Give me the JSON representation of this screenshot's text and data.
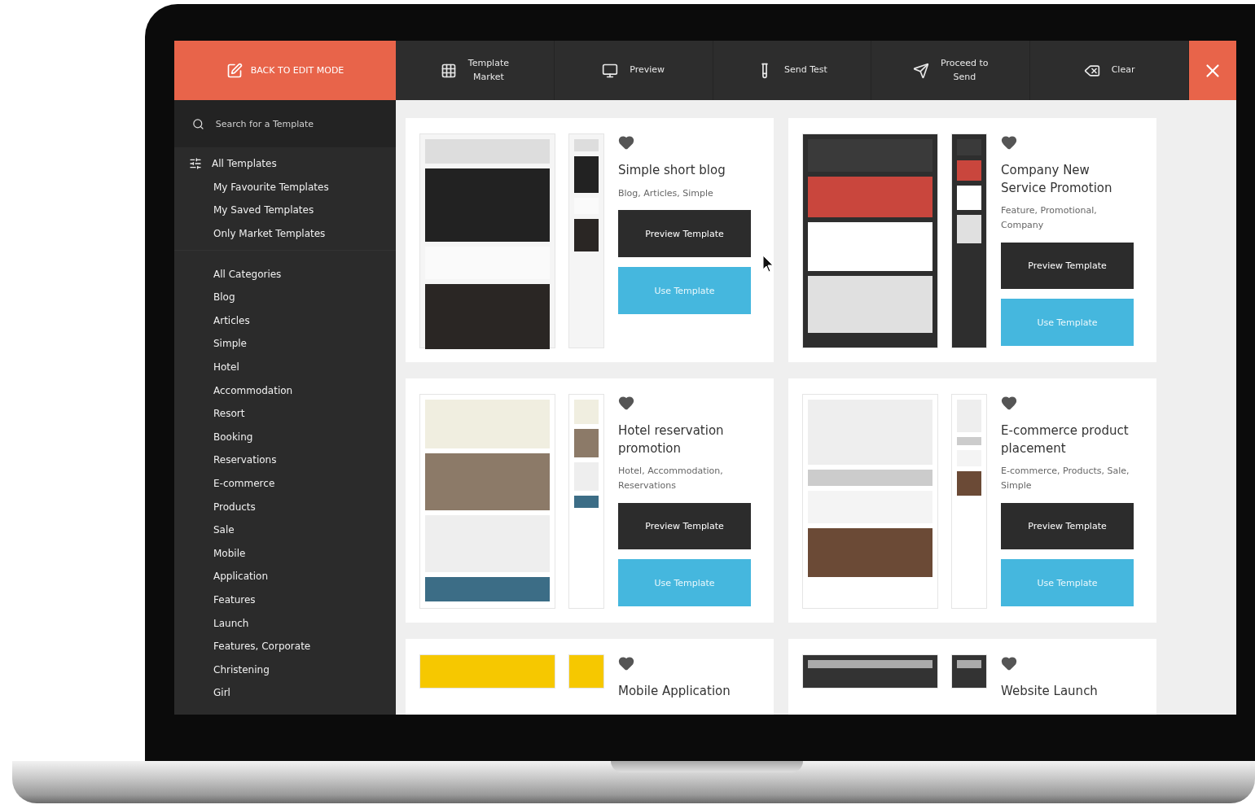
{
  "toolbar": {
    "back": {
      "label": "BACK TO EDIT MODE"
    },
    "items": [
      {
        "label": "Template\nMarket"
      },
      {
        "label": "Preview"
      },
      {
        "label": "Send Test"
      },
      {
        "label": "Proceed to\nSend"
      },
      {
        "label": "Clear"
      }
    ]
  },
  "sidebar": {
    "search": {
      "placeholder": "Search for a Template"
    },
    "filters": [
      "All Templates",
      "My Favourite Templates",
      "My Saved Templates",
      "Only Market Templates"
    ],
    "categories": [
      "All Categories",
      "Blog",
      "Articles",
      "Simple",
      "Hotel",
      "Accommodation",
      "Resort",
      "Booking",
      "Reservations",
      "E-commerce",
      "Products",
      "Sale",
      "Mobile",
      "Application",
      "Features",
      "Launch",
      "Features, Corporate",
      "Christening",
      "Girl"
    ]
  },
  "templates": [
    {
      "title": "Simple short blog",
      "tags": "Blog, Articles, Simple",
      "preview_label": "Preview Template",
      "use_label": "Use Template"
    },
    {
      "title": "Company New Service Promotion",
      "tags": "Feature, Promotional, Company",
      "preview_label": "Preview Template",
      "use_label": "Use Template"
    },
    {
      "title": "Hotel reservation promotion",
      "tags": "Hotel, Accommodation, Reservations",
      "preview_label": "Preview Template",
      "use_label": "Use Template"
    },
    {
      "title": "E-commerce product placement",
      "tags": "E-commerce, Products, Sale, Simple",
      "preview_label": "Preview Template",
      "use_label": "Use Template"
    },
    {
      "title": "Mobile Application"
    },
    {
      "title": "Website Launch"
    }
  ]
}
